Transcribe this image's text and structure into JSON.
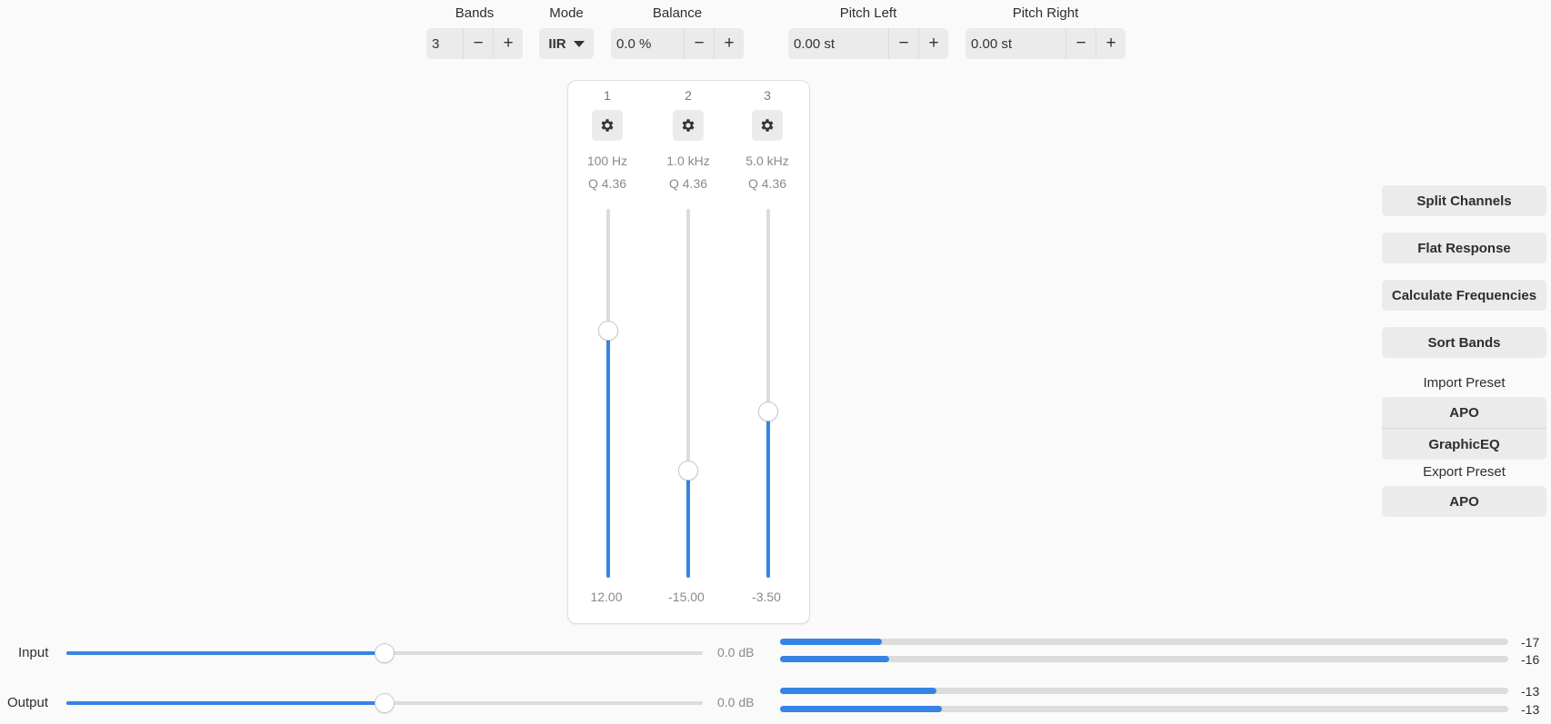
{
  "top": {
    "bands": {
      "label": "Bands",
      "value": "3",
      "minus": "−",
      "plus": "+"
    },
    "mode": {
      "label": "Mode",
      "value": "IIR"
    },
    "balance": {
      "label": "Balance",
      "value": "0.0 %",
      "minus": "−",
      "plus": "+"
    },
    "pitch_left": {
      "label": "Pitch Left",
      "value": "0.00 st",
      "minus": "−",
      "plus": "+"
    },
    "pitch_right": {
      "label": "Pitch Right",
      "value": "0.00 st",
      "minus": "−",
      "plus": "+"
    }
  },
  "bands": [
    {
      "number": "1",
      "frequency": "100 Hz",
      "q": "Q 4.36",
      "gain": "12.00",
      "level": 0.67
    },
    {
      "number": "2",
      "frequency": "1.0 kHz",
      "q": "Q 4.36",
      "gain": "-15.00",
      "level": 0.29
    },
    {
      "number": "3",
      "frequency": "5.0 kHz",
      "q": "Q 4.36",
      "gain": "-3.50",
      "level": 0.45
    }
  ],
  "sidebar": {
    "split_channels": "Split Channels",
    "flat_response": "Flat Response",
    "calculate_frequencies": "Calculate Frequencies",
    "sort_bands": "Sort Bands",
    "import_label": "Import Preset",
    "import_apo": "APO",
    "import_graphiceq": "GraphicEQ",
    "export_label": "Export Preset",
    "export_apo": "APO"
  },
  "input": {
    "label": "Input",
    "value": "0.0 dB",
    "slider_level": 0.5,
    "meters": [
      {
        "value": "-17",
        "level": 0.14
      },
      {
        "value": "-16",
        "level": 0.15
      }
    ]
  },
  "output": {
    "label": "Output",
    "value": "0.0 dB",
    "slider_level": 0.5,
    "meters": [
      {
        "value": "-13",
        "level": 0.215
      },
      {
        "value": "-13",
        "level": 0.222
      }
    ]
  },
  "colors": {
    "accent": "#3584e4",
    "track": "#dcdcdc",
    "button": "#ebebeb"
  }
}
